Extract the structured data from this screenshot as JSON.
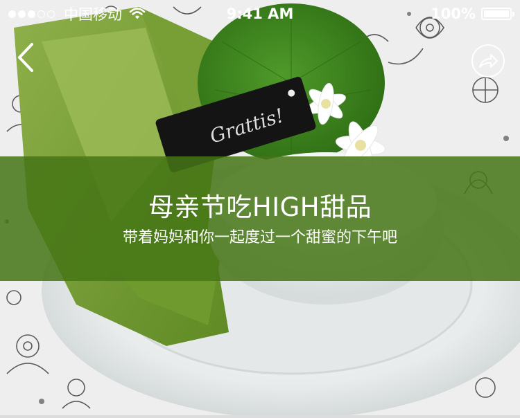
{
  "status_bar": {
    "signal_filled": 3,
    "signal_total": 5,
    "carrier": "中国移动",
    "time": "9:41 AM",
    "battery": "100%",
    "battery_level": 1.0
  },
  "nav": {
    "back_icon": "chevron-left-icon",
    "share_icon": "share-arrow-icon"
  },
  "hero": {
    "tag_text": "Grattis!"
  },
  "banner": {
    "title": "母亲节吃HIGH甜品",
    "subtitle": "带着妈妈和你一起度过一个甜蜜的下午吧",
    "color": "#467616"
  }
}
